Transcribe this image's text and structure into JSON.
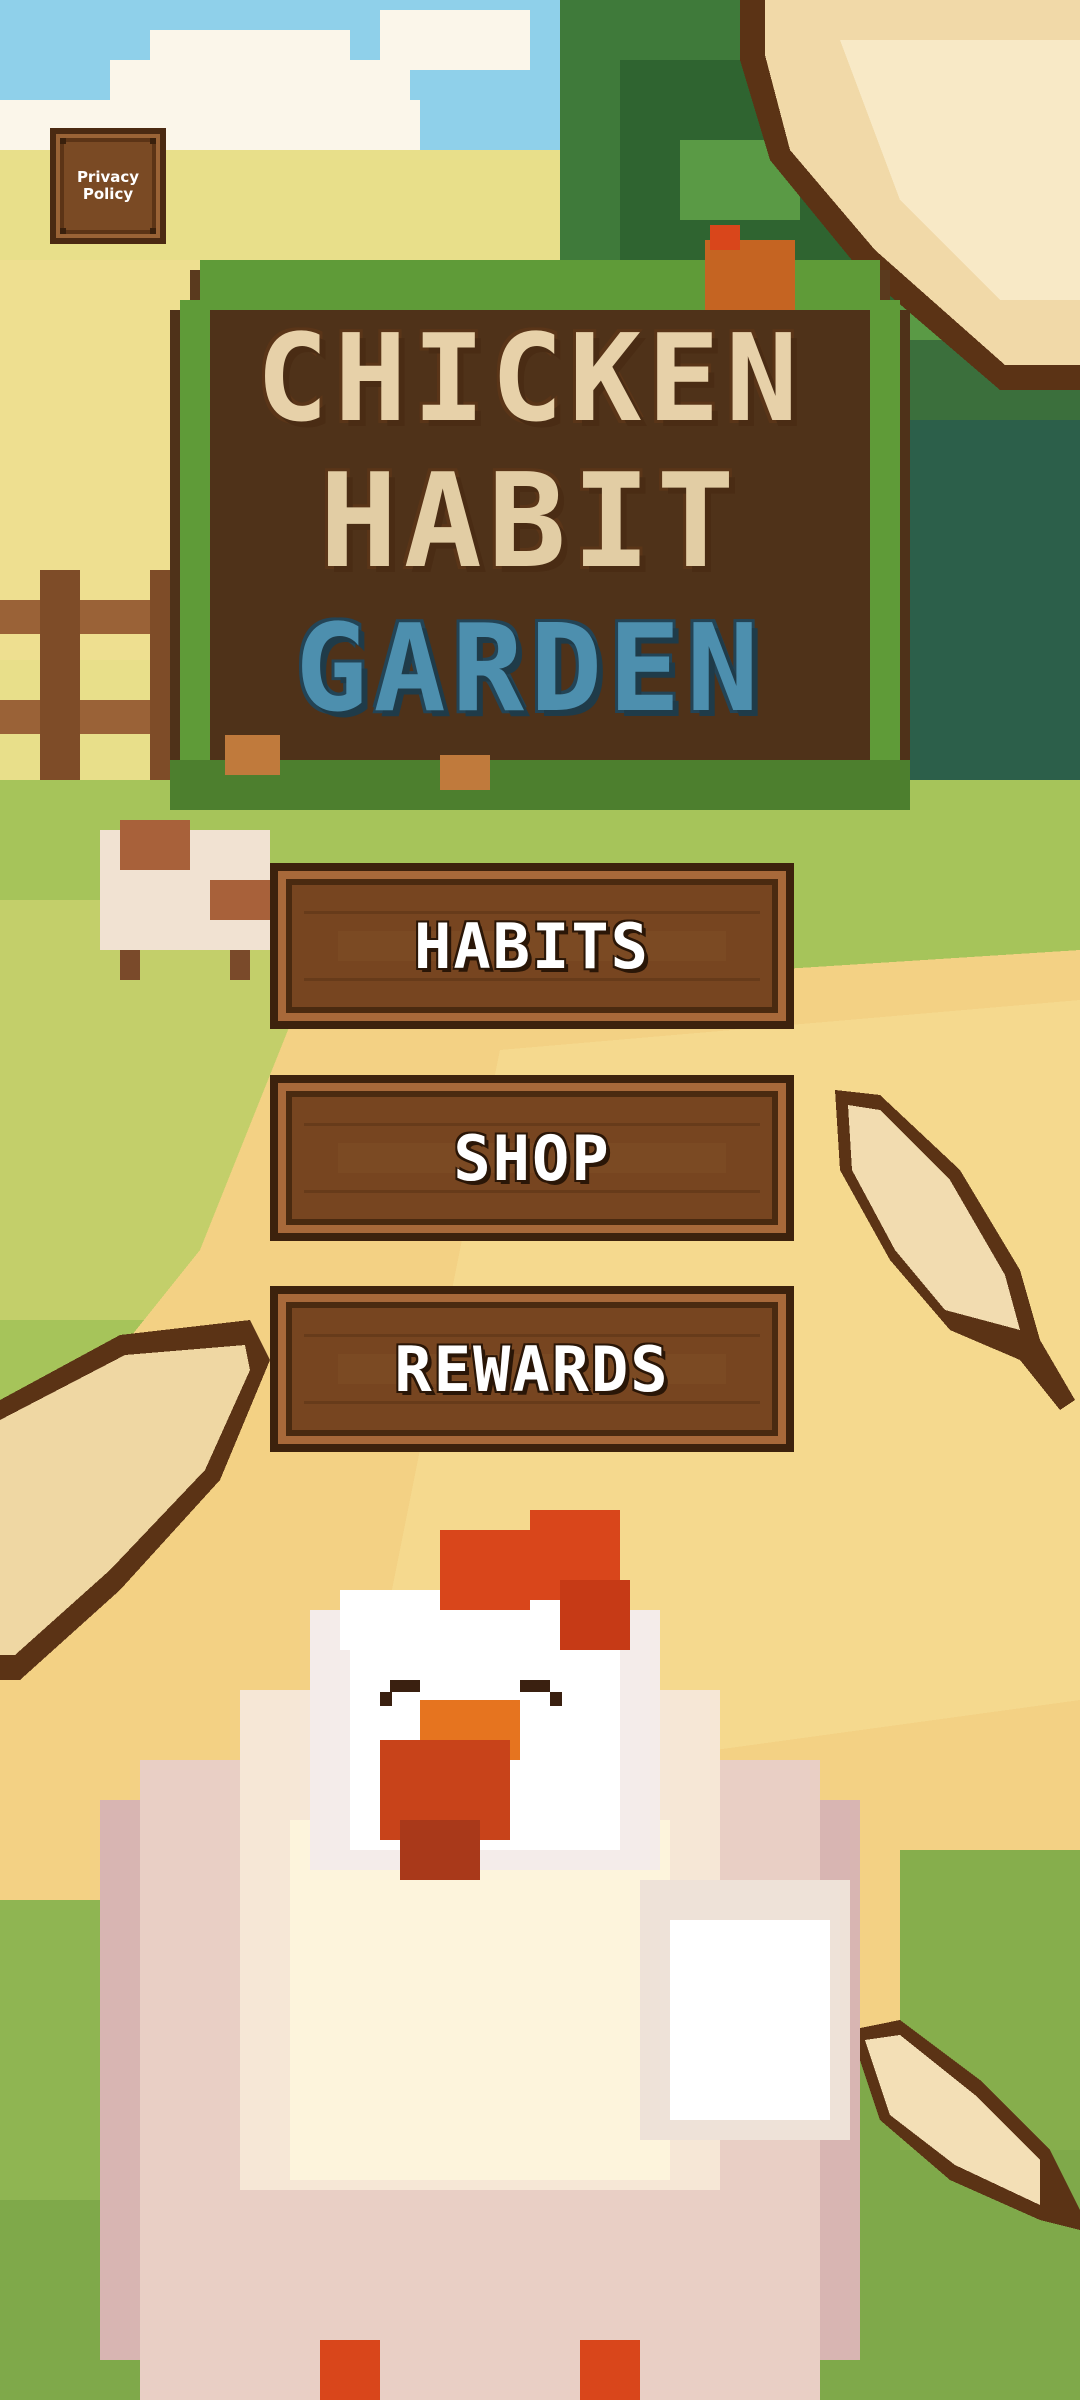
{
  "privacy": {
    "label": "Privacy Policy"
  },
  "logo": {
    "line1": "CHICKEN",
    "line2": "HABIT",
    "line3": "GARDEN"
  },
  "menu": {
    "habits": "HABITS",
    "shop": "SHOP",
    "rewards": "REWARDS"
  },
  "colors": {
    "sky": "#7ec7e6",
    "grass": "#8fbd4a",
    "sand": "#f2cf7c",
    "wood": "#7b4a23",
    "wood_dark": "#3d220d",
    "logo_stone": "#e2cda4",
    "logo_blue": "#4d8fae",
    "comb": "#d9461b"
  }
}
